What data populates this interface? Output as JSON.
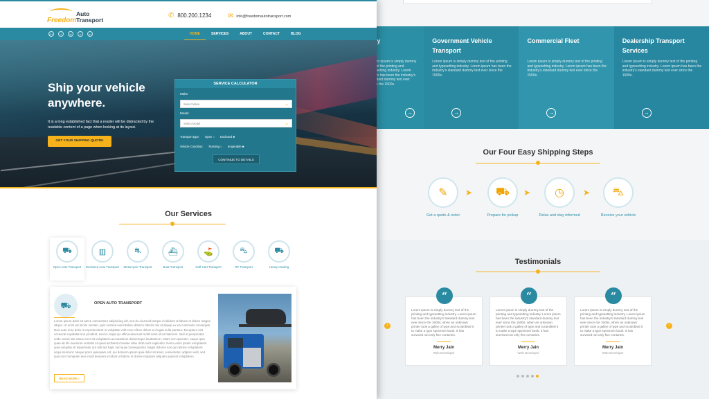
{
  "header": {
    "logo_top": "Freedom",
    "logo_name": "Auto Transport",
    "phone": "800.200.1234",
    "email": "info@freedomautotransport.com"
  },
  "social": [
    "G+",
    "f",
    "in",
    "t",
    "in"
  ],
  "nav": [
    "HOME",
    "SERVICES",
    "ABOUT",
    "CONTACT",
    "BLOG"
  ],
  "hero": {
    "title": "Ship your vehicle anywhere.",
    "subtitle": "It is a long established fact that a reader will be distracted by the readable content of a page when looking at its layout.",
    "cta": "GET YOUR SHIPPING QUOTE!"
  },
  "calculator": {
    "title": "SERVICE CALCULATOR",
    "make_label": "Make:",
    "make_placeholder": "Select Make",
    "model_label": "Model:",
    "model_placeholder": "Select Model",
    "transport_label": "Transport type:",
    "transport_opt1": "Open",
    "transport_opt2": "Enclosed",
    "condition_label": "Vehicle Condition:",
    "condition_opt1": "Running",
    "condition_opt2": "Inoperable",
    "button": "CONTINUE TO DETAILS"
  },
  "services": {
    "title": "Our Services",
    "items": [
      {
        "label": "Open Auto Transport",
        "icon": "truck-icon"
      },
      {
        "label": "Enclosed Auto Transport",
        "icon": "enclosed-trailer-icon"
      },
      {
        "label": "Motorcycle Transport",
        "icon": "motorcycle-icon"
      },
      {
        "label": "Boat Transport",
        "icon": "boat-icon"
      },
      {
        "label": "Golf Cart Transport",
        "icon": "golf-cart-icon"
      },
      {
        "label": "RV Transport",
        "icon": "rv-icon"
      },
      {
        "label": "Heavy Hauling",
        "icon": "heavy-hauler-icon"
      }
    ],
    "detail_title": "OPEN AUTO TRANSPORT",
    "detail_text": "Lorem ipsum dolor sit amet, consectetur adipisicing elit, sed do eiusmod tempor incididunt ut labore et dolore magna aliqua. Ut enim ad minim veniam, quis nostrud exercitation ullamco laboris nisi ut aliquip ex ea commodo consequat. Duis aute irure dolor in reprehenderit in voluptate velit esse cillum dolore eu fugiat nulla pariatur. Excepteur sint occaecat cupidatat non proident, sunt in culpa qui officia deserunt mollit anim id est laborum. Sed ut perspiciatis unde omnis iste natus error sit voluptatem accusantium doloremque laudantium, totam rem aperiam, eaque ipsa quae ab illo inventore veritatis et quasi architecto beatae vitae dicta sunt explicabo. Nemo enim ipsam voluptatem quia voluptas sit aspernatur aut odit aut fugit, sed quia consequuntur magni dolores eos qui ratione voluptatem sequi nesciunt. Neque porro quisquam est, qui dolorem ipsum quia dolor sit amet, consectetur, adipisci velit, sed quia non numquam eius modi tempora incidunt ut labore et dolore magnam aliquam quaerat voluptatem.",
    "read_more": "READ MORE ›"
  },
  "cards": [
    {
      "title": "any",
      "text": "Lorem ipsum is simply dummy text of the printing and typesetting industry. Lorem ipsum has been the industry's standard dummy text ever since the 1500s."
    },
    {
      "title": "Government Vehicle Transport",
      "text": "Lorem ipsum is simply dummy text of the printing and typesetting industry. Lorem ipsum has been the industry's standard dummy text ever since the 1500s."
    },
    {
      "title": "Commercial Fleet",
      "text": "Lorem ipsum is simply dummy text of the printing and typesetting industry. Lorem ipsum has been the industry's standard dummy text ever since the 1500s."
    },
    {
      "title": "Dealership Transport Services",
      "text": "Lorem ipsum is simply dummy text of the printing and typesetting industry. Lorem ipsum has been the industry's standard dummy text ever since the 1500s."
    }
  ],
  "steps": {
    "title": "Our Four Easy Shipping Steps",
    "items": [
      {
        "label": "Get a quote & order",
        "icon": "clipboard-icon"
      },
      {
        "label": "Prepare for pickup",
        "icon": "truck-icon"
      },
      {
        "label": "Relax and stay informed",
        "icon": "clock-icon"
      },
      {
        "label": "Receive your vehicle",
        "icon": "car-icon"
      }
    ]
  },
  "testimonials": {
    "title": "Testimonials",
    "items": [
      {
        "text": "Lorem ipsum is simply dummy text of the printing and typesetting industry. Lorem ipsum has been the industry's standard dummy text ever since the 1500s, when an unknown printer took a galley of type and scrambled it to make a type specimen book. It has survived not only five centuries.",
        "name": "Merry Jain",
        "role": "Web Developer"
      },
      {
        "text": "Lorem ipsum is simply dummy text of the printing and typesetting industry. Lorem ipsum has been the industry's standard dummy text ever since the 1500s, when an unknown printer took a galley of type and scrambled it to make a type specimen book. It has survived not only five centuries.",
        "name": "Merry Jain",
        "role": "Web Developer"
      },
      {
        "text": "Lorem ipsum is simply dummy text of the printing and typesetting industry. Lorem ipsum has been the industry's standard dummy text ever since the 1500s, when an unknown printer took a galley of type and scrambled it to make a type specimen book. It has survived not only five centuries.",
        "name": "Merry Jain",
        "role": "Web Developer"
      }
    ]
  },
  "colors": {
    "accent": "#f6b21a",
    "brand": "#2a8aa1"
  }
}
